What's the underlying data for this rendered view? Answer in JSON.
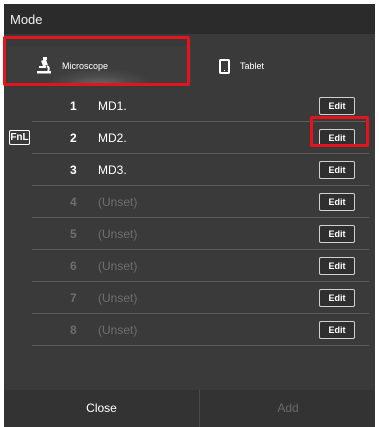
{
  "dialog": {
    "title": "Mode",
    "tabs": [
      {
        "label": "Microscope",
        "icon": "microscope-icon",
        "selected": true
      },
      {
        "label": "Tablet",
        "icon": "tablet-icon",
        "selected": false
      }
    ],
    "memories": [
      {
        "number": "1",
        "name": "MD1.",
        "edit_label": "Edit",
        "unset": false,
        "badge": ""
      },
      {
        "number": "2",
        "name": "MD2.",
        "edit_label": "Edit",
        "unset": false,
        "badge": "FnL"
      },
      {
        "number": "3",
        "name": "MD3.",
        "edit_label": "Edit",
        "unset": false,
        "badge": ""
      },
      {
        "number": "4",
        "name": "(Unset)",
        "edit_label": "Edit",
        "unset": true,
        "badge": ""
      },
      {
        "number": "5",
        "name": "(Unset)",
        "edit_label": "Edit",
        "unset": true,
        "badge": ""
      },
      {
        "number": "6",
        "name": "(Unset)",
        "edit_label": "Edit",
        "unset": true,
        "badge": ""
      },
      {
        "number": "7",
        "name": "(Unset)",
        "edit_label": "Edit",
        "unset": true,
        "badge": ""
      },
      {
        "number": "8",
        "name": "(Unset)",
        "edit_label": "Edit",
        "unset": true,
        "badge": ""
      }
    ],
    "footer": {
      "close_label": "Close",
      "add_label": "Add"
    }
  },
  "colors": {
    "highlight": "#e4141f",
    "background": "#3a3a3a",
    "text": "#ffffff",
    "disabled_text": "#6e6e6e"
  }
}
